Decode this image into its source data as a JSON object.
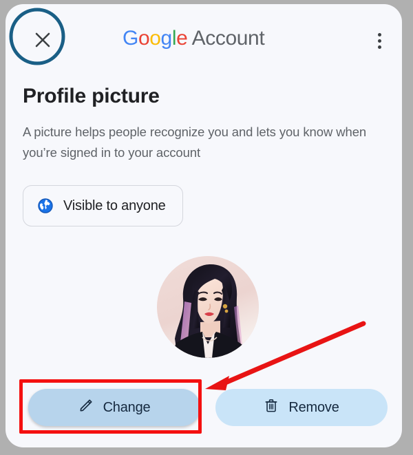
{
  "window": {
    "background_color": "#b0b0b0",
    "card_background": "#f7f8fc"
  },
  "header": {
    "close_icon": "close-x-icon",
    "close_label": "Close",
    "brand": {
      "logo_letters": [
        {
          "char": "G",
          "color": "#4285f4"
        },
        {
          "char": "o",
          "color": "#ea4335"
        },
        {
          "char": "o",
          "color": "#fbbc05"
        },
        {
          "char": "g",
          "color": "#4285f4"
        },
        {
          "char": "l",
          "color": "#34a853"
        },
        {
          "char": "e",
          "color": "#ea4335"
        }
      ],
      "logo_text": "Google",
      "suffix": " Account",
      "full_text": "Google Account"
    },
    "overflow_icon": "more-vertical-icon",
    "overflow_label": "More options"
  },
  "main": {
    "title": "Profile picture",
    "description": "A picture helps people recognize you and lets you know when you’re signed in to your account",
    "visibility": {
      "icon": "globe-icon",
      "label": "Visible to anyone",
      "icon_color": "#1a73e8"
    },
    "avatar": {
      "name": "profile-avatar",
      "alt": "Profile picture",
      "background_color": "#efd9d6"
    }
  },
  "actions": {
    "change": {
      "label": "Change",
      "icon": "pencil-edit-icon",
      "background": "#b7d4ec",
      "text_color": "#15293f"
    },
    "remove": {
      "label": "Remove",
      "icon": "trash-delete-icon",
      "background": "#c9e4f8",
      "text_color": "#15293f"
    }
  },
  "annotations": {
    "circle": {
      "name": "annotation-circle-close",
      "color": "#1a5f86",
      "target": "close-button"
    },
    "highlight_box": {
      "name": "annotation-box-change",
      "color": "#f41010",
      "target": "change-button"
    },
    "arrow": {
      "name": "annotation-arrow",
      "color": "#e81414",
      "points_to": "change-button"
    }
  }
}
